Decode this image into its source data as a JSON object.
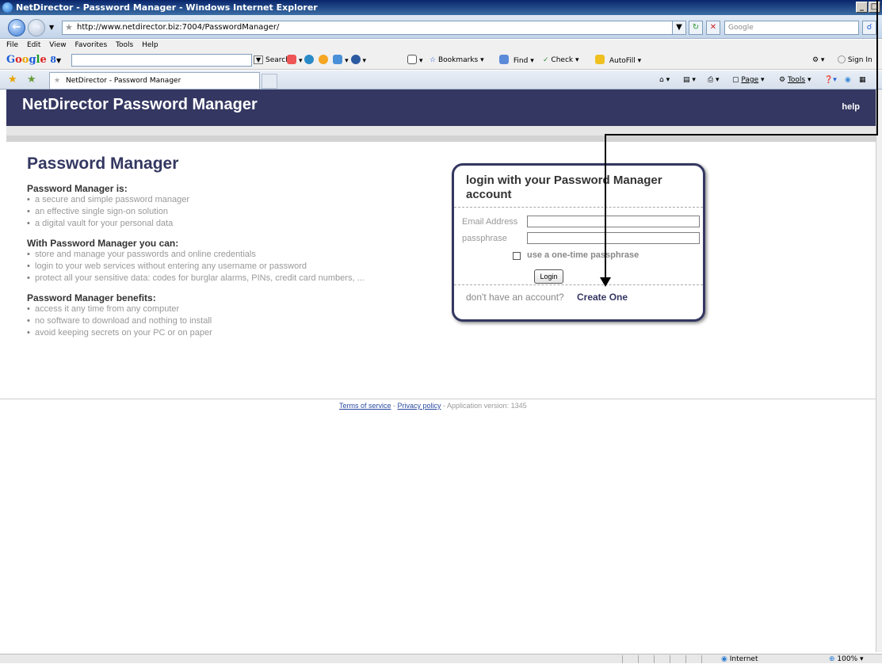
{
  "window": {
    "title": "NetDirector - Password Manager - Windows Internet Explorer"
  },
  "address": {
    "url": "http://www.netdirector.biz:7004/PasswordManager/",
    "search_placeholder": "Google"
  },
  "menu": [
    "File",
    "Edit",
    "View",
    "Favorites",
    "Tools",
    "Help"
  ],
  "google_toolbar": {
    "search_label": "Search",
    "bookmarks": "Bookmarks",
    "find": "Find",
    "check": "Check",
    "autofill": "AutoFill",
    "sign_in": "Sign In"
  },
  "tabbar": {
    "tab_title": "NetDirector - Password Manager",
    "page": "Page",
    "tools": "Tools"
  },
  "header": {
    "title": "NetDirector Password Manager",
    "help": "help"
  },
  "content": {
    "heading": "Password Manager",
    "sections": [
      {
        "title": "Password Manager is:",
        "items": [
          "a secure and simple password manager",
          "an effective single sign-on solution",
          "a digital vault for your personal data"
        ]
      },
      {
        "title": "With Password Manager you can:",
        "items": [
          "store and manage your passwords and online credentials",
          "login to your web services without entering any username or password",
          "protect all your sensitive data: codes for burglar alarms, PINs, credit card numbers, ..."
        ]
      },
      {
        "title": "Password Manager benefits:",
        "items": [
          "access it any time from any computer",
          "no software to download and nothing to install",
          "avoid keeping secrets on your PC or on paper"
        ]
      }
    ]
  },
  "login": {
    "title": "login with your Password Manager account",
    "email_label": "Email Address",
    "passphrase_label": "passphrase",
    "one_time_label": "use a one-time passphrase",
    "login_button": "Login",
    "no_account": "don't have an account?",
    "create_link": "Create One"
  },
  "footer": {
    "terms": "Terms of service",
    "privacy": "Privacy policy",
    "version": "Application version: 1345"
  },
  "statusbar": {
    "zone": "Internet",
    "zoom": "100%"
  }
}
